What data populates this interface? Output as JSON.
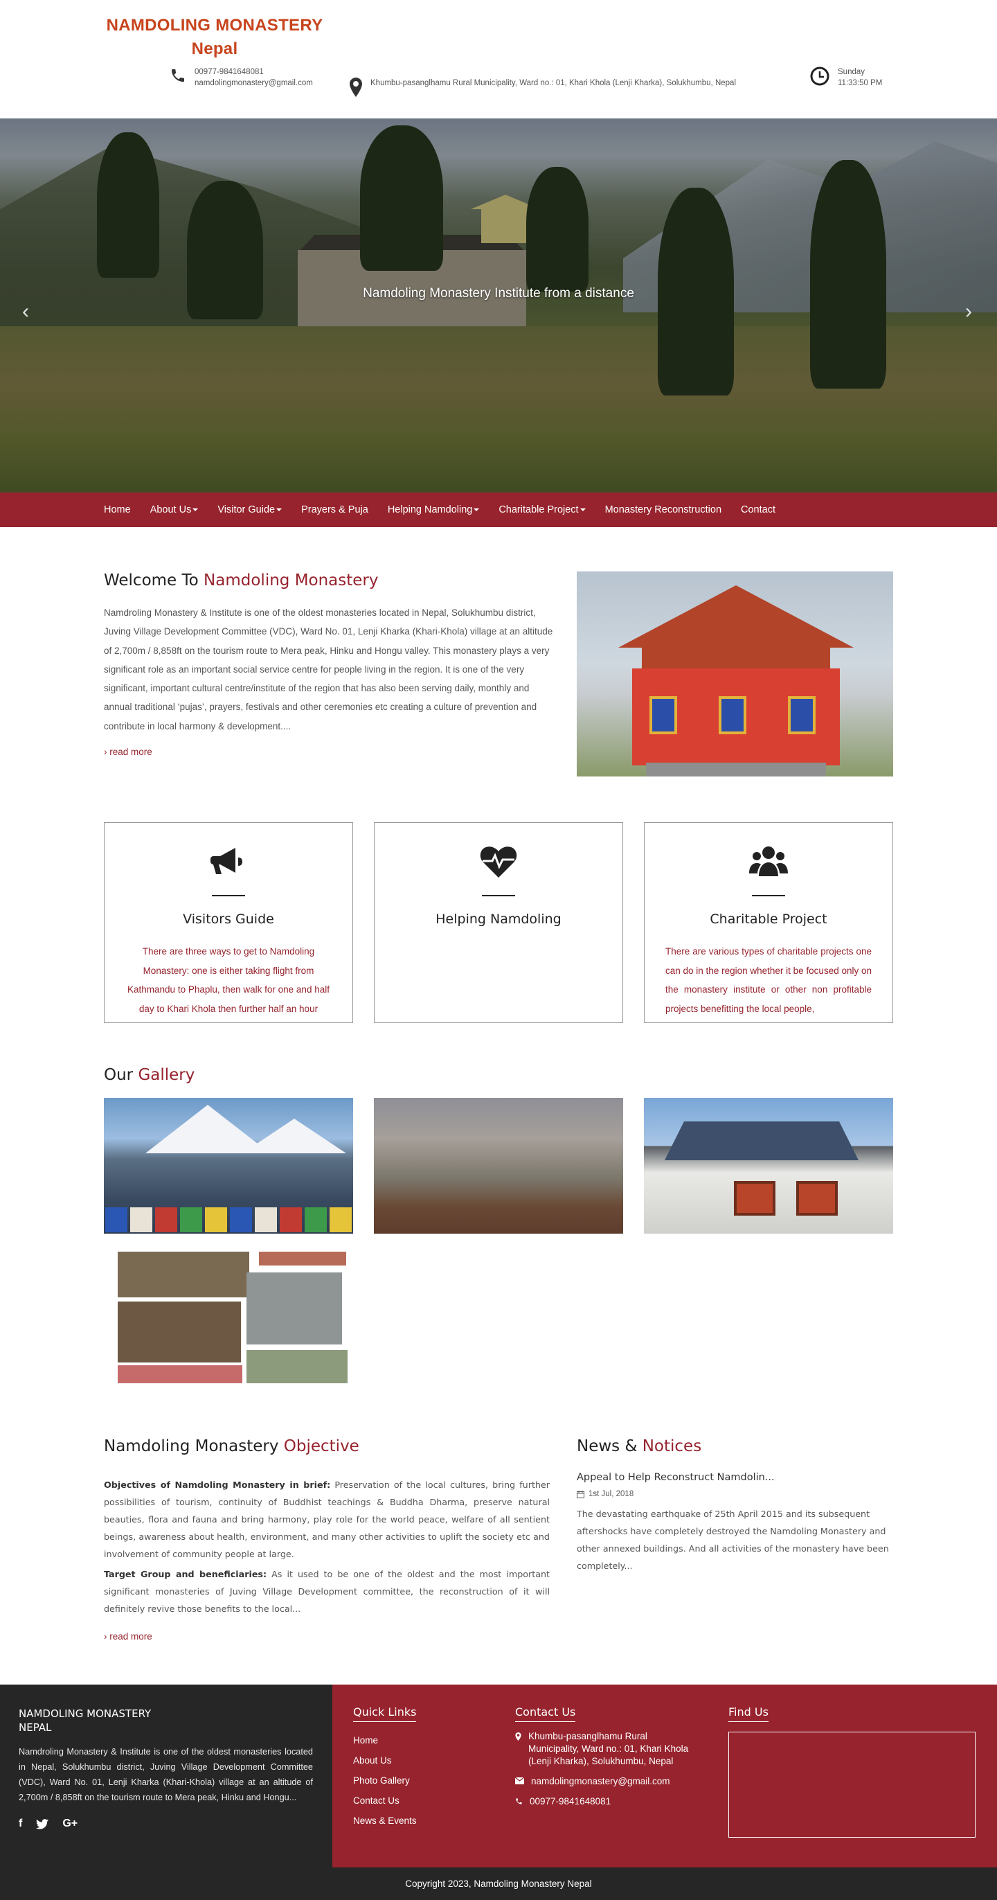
{
  "site": {
    "brand_line1": "NAMDOLING MONASTERY",
    "brand_line2": "Nepal",
    "phone": "00977-9841648081",
    "email": "namdolingmonastery@gmail.com",
    "address": "Khumbu-pasanglhamu Rural Municipality, Ward no.: 01, Khari Khola (Lenji Kharka), Solukhumbu, Nepal",
    "day": "Sunday",
    "time": "11:33:50 PM"
  },
  "hero": {
    "caption": "Namdoling Monastery Institute from a distance",
    "prev": "‹",
    "next": "›"
  },
  "nav": {
    "items": [
      {
        "label": "Home"
      },
      {
        "label": "About Us"
      },
      {
        "label": "Visitor Guide"
      },
      {
        "label": "Prayers & Puja"
      },
      {
        "label": "Helping Namdoling"
      },
      {
        "label": "Charitable Project"
      },
      {
        "label": "Monastery Reconstruction"
      },
      {
        "label": "Contact"
      }
    ]
  },
  "welcome": {
    "title_plain": "Welcome To",
    "title_accent": "Namdoling Monastery",
    "body": "Namdroling Monastery & Institute is one of the oldest monasteries located in Nepal, Solukhumbu district, Juving Village Development Committee (VDC), Ward No. 01, Lenji Kharka (Khari-Khola) village at an altitude of 2,700m / 8,858ft on the tourism route to Mera peak, Hinku and Hongu valley. This monastery plays a very significant role as an important social service centre for people living in the region. It is one of the very significant, important cultural centre/institute of  the region that has also been serving daily, monthly and annual traditional ‘pujas’, prayers, festivals and other ceremonies etc creating a culture of prevention and contribute in local harmony & development....",
    "read_more": "› read more"
  },
  "features": [
    {
      "icon": "megaphone-icon",
      "title": "Visitors Guide",
      "text": "There are three ways to get to Namdoling Monastery: one is either taking flight from Kathmandu to Phaplu, then walk for one and half day to Khari Khola then further half an hour"
    },
    {
      "icon": "heartbeat-icon",
      "title": "Helping Namdoling",
      "text": ""
    },
    {
      "icon": "users-icon",
      "title": "Charitable Project",
      "text": "There are various types of charitable projects one can do in the region whether it be focused only on the monastery institute or other non profitable projects benefitting the local people,"
    }
  ],
  "gallery": {
    "title_plain": "Our",
    "title_accent": "Gallery"
  },
  "objective": {
    "title_plain": "Namdoling Monastery",
    "title_accent": "Objective",
    "p1_bold": "Objectives of Namdoling Monastery in brief:",
    "p1": " Preservation of the local cultures, bring further possibilities of tourism, continuity of Buddhist teachings & Buddha Dharma, preserve natural beauties, flora and fauna and bring harmony, play role for the world peace, welfare of all sentient beings, awareness about health, environment, and many other activities to uplift the society etc and involvement of community people at large.",
    "p2_bold": "Target Group and beneficiaries:",
    "p2": "  As it used to be one of the oldest and the most important significant monasteries of Juving Village Development committee, the reconstruction of it will  definitely revive those benefits to the local...",
    "read_more": "› read more"
  },
  "news": {
    "title_plain": "News &",
    "title_accent": "Notices",
    "item_title": "Appeal to Help Reconstruct Namdolin...",
    "item_date": "1st Jul, 2018",
    "item_body": "The devastating earthquake of 25th April 2015 and its subsequent aftershocks have completely destroyed the Namdoling Monastery and other annexed buildings. And all activities of the monastery have been completely..."
  },
  "footer": {
    "brand_line1": "NAMDOLING MONASTERY",
    "brand_line2": "NEPAL",
    "about": "Namdroling Monastery & Institute is one of the oldest monasteries located in Nepal, Solukhumbu district, Juving Village Development Committee (VDC), Ward No. 01, Lenji Kharka (Khari-Khola) village at an altitude of 2,700m / 8,858ft on the tourism route to Mera peak, Hinku and Hongu...",
    "social": [
      "f",
      "t",
      "G+"
    ],
    "quick_links_title": "Quick Links",
    "quick_links": [
      "Home",
      "About Us",
      "Photo Gallery",
      "Contact Us",
      "News & Events"
    ],
    "contact_title": "Contact Us",
    "contact_address": "Khumbu-pasanglhamu Rural Municipality, Ward no.: 01, Khari Khola (Lenji Kharka), Solukhumbu, Nepal",
    "contact_email": "namdolingmonastery@gmail.com",
    "contact_phone": "00977-9841648081",
    "find_us_title": "Find Us",
    "copyright": "Copyright 2023, Namdoling Monastery Nepal"
  },
  "colors": {
    "brand_orange": "#c7441d",
    "accent_red": "#96232d",
    "footer_dark": "#262626"
  }
}
